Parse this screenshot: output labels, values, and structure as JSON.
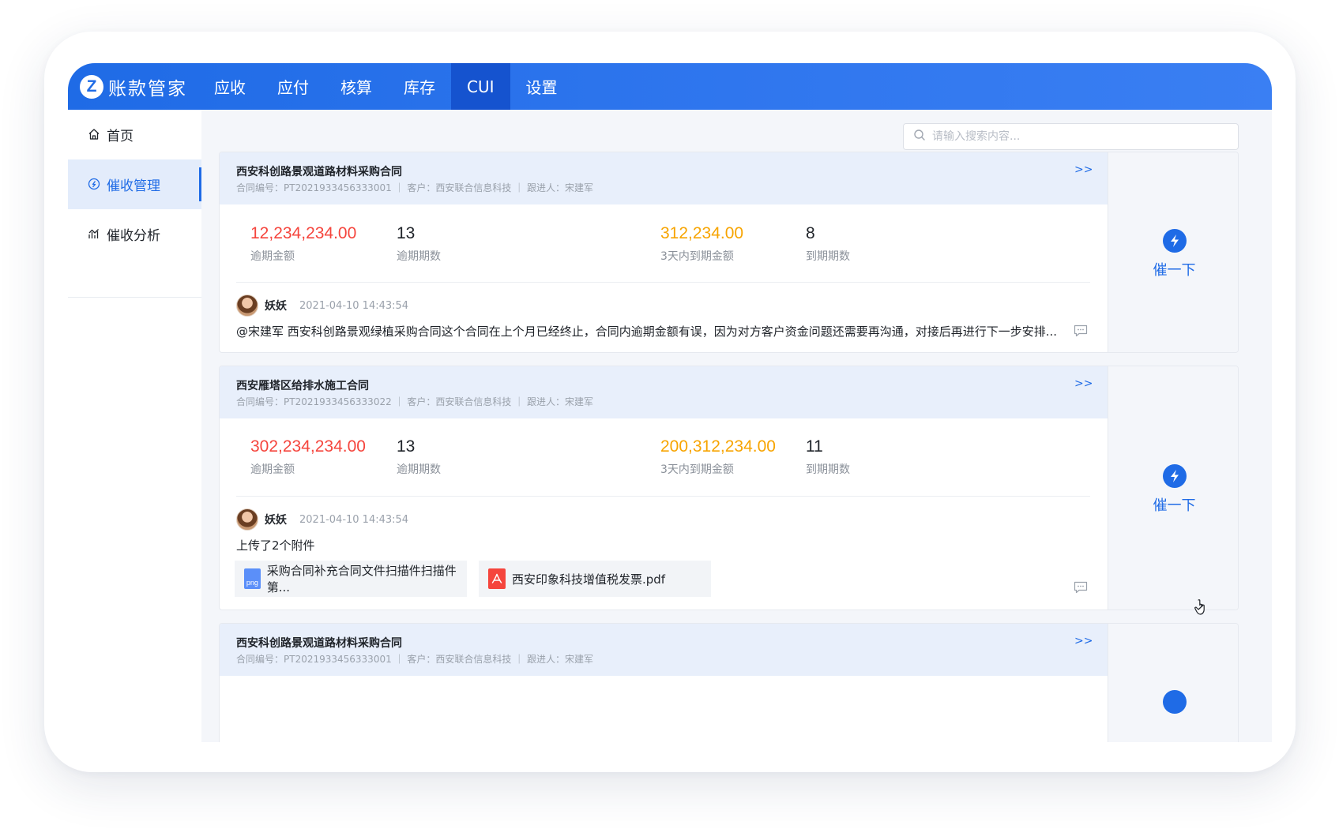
{
  "app": {
    "logo_letter": "Z",
    "name": "账款管家"
  },
  "nav": [
    {
      "label": "应收"
    },
    {
      "label": "应付"
    },
    {
      "label": "核算"
    },
    {
      "label": "库存"
    },
    {
      "label": "CUI",
      "active": true
    },
    {
      "label": "设置"
    }
  ],
  "sidebar": {
    "items": [
      {
        "label": "首页",
        "icon": "home-icon"
      },
      {
        "label": "催收管理",
        "icon": "collection-icon",
        "active": true
      },
      {
        "label": "催收分析",
        "icon": "analytics-icon"
      }
    ]
  },
  "search": {
    "placeholder": "请输入搜索内容..."
  },
  "cards": [
    {
      "title": "西安科创路景观道路材料采购合同",
      "sub": "合同编号：PT2021933456333001 ｜ 客户：西安联合信息科技 ｜ 跟进人：宋建军",
      "more": ">>",
      "overdue_amount": "12,234,234.00",
      "overdue_amount_label": "逾期金额",
      "overdue_periods": "13",
      "overdue_periods_label": "逾期期数",
      "due3_amount": "312,234.00",
      "due3_amount_label": "3天内到期金额",
      "due_periods": "8",
      "due_periods_label": "到期期数",
      "author": "妖妖",
      "time": "2021-04-10  14:43:54",
      "comment": "@宋建军 西安科创路景观绿植采购合同这个合同在上个月已经终止，合同内逾期金额有误，因为对方客户资金问题还需要再沟通，对接后再进行下一步安排...",
      "action": "催一下"
    },
    {
      "title": "西安雁塔区给排水施工合同",
      "sub": "合同编号：PT2021933456333022 ｜ 客户：西安联合信息科技 ｜ 跟进人：宋建军",
      "more": ">>",
      "overdue_amount": "302,234,234.00",
      "overdue_amount_label": "逾期金额",
      "overdue_periods": "13",
      "overdue_periods_label": "逾期期数",
      "due3_amount": "200,312,234.00",
      "due3_amount_label": "3天内到期金额",
      "due_periods": "11",
      "due_periods_label": "到期期数",
      "author": "妖妖",
      "time": "2021-04-10  14:43:54",
      "comment": "上传了2个附件",
      "attachments": [
        {
          "type": "png",
          "name": "采购合同补充合同文件扫描件扫描件第..."
        },
        {
          "type": "pdf",
          "name": "西安印象科技增值税发票.pdf"
        }
      ],
      "action": "催一下"
    },
    {
      "title": "西安科创路景观道路材料采购合同",
      "sub": "合同编号：PT2021933456333001 ｜ 客户：西安联合信息科技 ｜ 跟进人：宋建军",
      "more": ">>"
    }
  ],
  "colors": {
    "primary": "#1f6be6",
    "overdue_red": "#f5453d",
    "due_orange": "#f7a400"
  }
}
